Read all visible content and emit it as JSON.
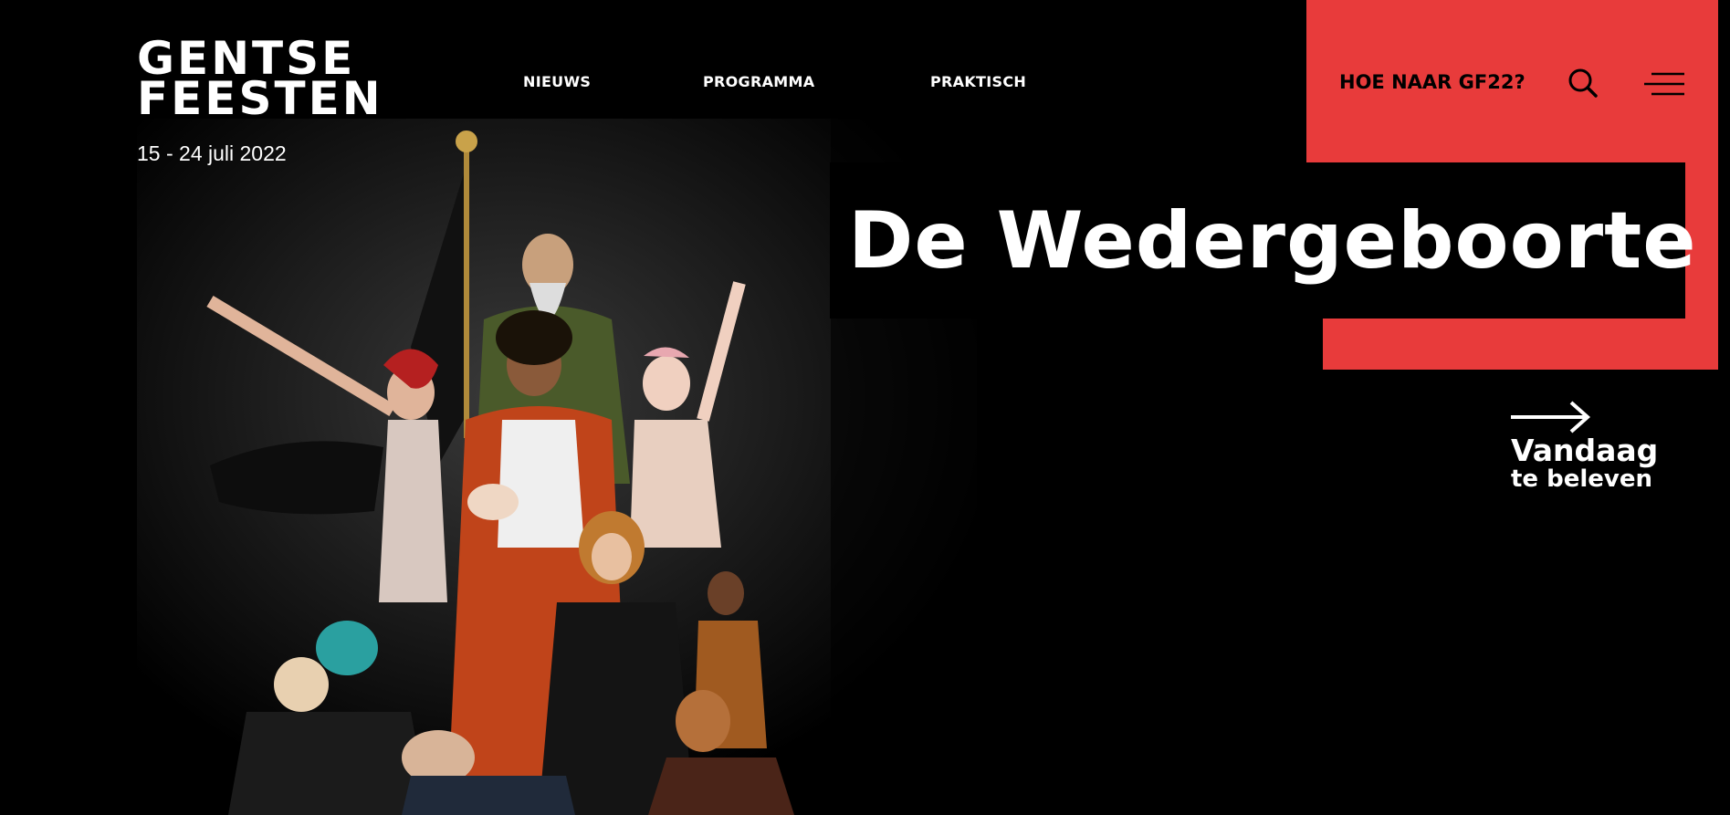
{
  "logo": {
    "line1": "GENTSE",
    "line2": "FEESTEN",
    "dates": "15 - 24 juli 2022"
  },
  "nav": {
    "items": [
      {
        "label": "NIEUWS"
      },
      {
        "label": "PROGRAMMA"
      },
      {
        "label": "PRAKTISCH"
      }
    ]
  },
  "header": {
    "cta_label": "HOE NAAR GF22?",
    "search_icon": "search-icon",
    "menu_icon": "menu-icon"
  },
  "hero": {
    "title": "De Wedergeboorte",
    "photo": "group-portrait-photo"
  },
  "today": {
    "line1": "Vandaag",
    "line2": "te beleven",
    "icon": "arrow-right-icon"
  },
  "colors": {
    "background": "#000000",
    "accent": "#e83b3b",
    "text": "#ffffff"
  }
}
